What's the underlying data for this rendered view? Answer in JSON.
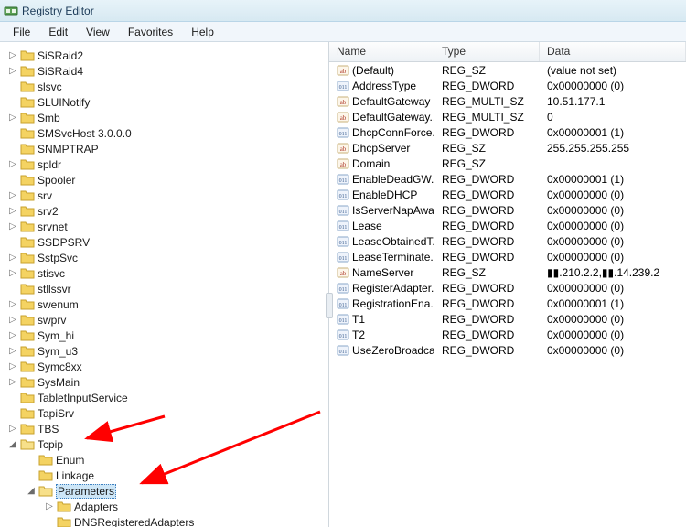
{
  "window": {
    "title": "Registry Editor"
  },
  "menu": {
    "items": [
      "File",
      "Edit",
      "View",
      "Favorites",
      "Help"
    ]
  },
  "tree": {
    "items": [
      {
        "label": "SiSRaid2",
        "indent": 1,
        "expandable": true
      },
      {
        "label": "SiSRaid4",
        "indent": 1,
        "expandable": true
      },
      {
        "label": "slsvc",
        "indent": 1,
        "expandable": false
      },
      {
        "label": "SLUINotify",
        "indent": 1,
        "expandable": false
      },
      {
        "label": "Smb",
        "indent": 1,
        "expandable": true
      },
      {
        "label": "SMSvcHost 3.0.0.0",
        "indent": 1,
        "expandable": false
      },
      {
        "label": "SNMPTRAP",
        "indent": 1,
        "expandable": false
      },
      {
        "label": "spldr",
        "indent": 1,
        "expandable": true
      },
      {
        "label": "Spooler",
        "indent": 1,
        "expandable": false
      },
      {
        "label": "srv",
        "indent": 1,
        "expandable": true
      },
      {
        "label": "srv2",
        "indent": 1,
        "expandable": true
      },
      {
        "label": "srvnet",
        "indent": 1,
        "expandable": true
      },
      {
        "label": "SSDPSRV",
        "indent": 1,
        "expandable": false
      },
      {
        "label": "SstpSvc",
        "indent": 1,
        "expandable": true
      },
      {
        "label": "stisvc",
        "indent": 1,
        "expandable": true
      },
      {
        "label": "stllssvr",
        "indent": 1,
        "expandable": false
      },
      {
        "label": "swenum",
        "indent": 1,
        "expandable": true
      },
      {
        "label": "swprv",
        "indent": 1,
        "expandable": true
      },
      {
        "label": "Sym_hi",
        "indent": 1,
        "expandable": true
      },
      {
        "label": "Sym_u3",
        "indent": 1,
        "expandable": true
      },
      {
        "label": "Symc8xx",
        "indent": 1,
        "expandable": true
      },
      {
        "label": "SysMain",
        "indent": 1,
        "expandable": true
      },
      {
        "label": "TabletInputService",
        "indent": 1,
        "expandable": false
      },
      {
        "label": "TapiSrv",
        "indent": 1,
        "expandable": false
      },
      {
        "label": "TBS",
        "indent": 1,
        "expandable": true
      },
      {
        "label": "Tcpip",
        "indent": 1,
        "expandable": true,
        "expanded": true
      },
      {
        "label": "Enum",
        "indent": 2,
        "expandable": false
      },
      {
        "label": "Linkage",
        "indent": 2,
        "expandable": false
      },
      {
        "label": "Parameters",
        "indent": 2,
        "expandable": true,
        "expanded": true,
        "selected": true
      },
      {
        "label": "Adapters",
        "indent": 3,
        "expandable": true
      },
      {
        "label": "DNSRegisteredAdapters",
        "indent": 3,
        "expandable": false
      }
    ]
  },
  "list": {
    "columns": {
      "name": "Name",
      "type": "Type",
      "data": "Data"
    },
    "rows": [
      {
        "icon": "ab",
        "name": "(Default)",
        "type": "REG_SZ",
        "data": "(value not set)"
      },
      {
        "icon": "bin",
        "name": "AddressType",
        "type": "REG_DWORD",
        "data": "0x00000000 (0)"
      },
      {
        "icon": "ab",
        "name": "DefaultGateway",
        "type": "REG_MULTI_SZ",
        "data": "10.51.177.1"
      },
      {
        "icon": "ab",
        "name": "DefaultGateway...",
        "type": "REG_MULTI_SZ",
        "data": "0"
      },
      {
        "icon": "bin",
        "name": "DhcpConnForce...",
        "type": "REG_DWORD",
        "data": "0x00000001 (1)"
      },
      {
        "icon": "ab",
        "name": "DhcpServer",
        "type": "REG_SZ",
        "data": "255.255.255.255"
      },
      {
        "icon": "ab",
        "name": "Domain",
        "type": "REG_SZ",
        "data": ""
      },
      {
        "icon": "bin",
        "name": "EnableDeadGW...",
        "type": "REG_DWORD",
        "data": "0x00000001 (1)"
      },
      {
        "icon": "bin",
        "name": "EnableDHCP",
        "type": "REG_DWORD",
        "data": "0x00000000 (0)"
      },
      {
        "icon": "bin",
        "name": "IsServerNapAware",
        "type": "REG_DWORD",
        "data": "0x00000000 (0)"
      },
      {
        "icon": "bin",
        "name": "Lease",
        "type": "REG_DWORD",
        "data": "0x00000000 (0)"
      },
      {
        "icon": "bin",
        "name": "LeaseObtainedT...",
        "type": "REG_DWORD",
        "data": "0x00000000 (0)"
      },
      {
        "icon": "bin",
        "name": "LeaseTerminate...",
        "type": "REG_DWORD",
        "data": "0x00000000 (0)"
      },
      {
        "icon": "ab",
        "name": "NameServer",
        "type": "REG_SZ",
        "data": "▮▮.210.2.2,▮▮.14.239.2"
      },
      {
        "icon": "bin",
        "name": "RegisterAdapter...",
        "type": "REG_DWORD",
        "data": "0x00000000 (0)"
      },
      {
        "icon": "bin",
        "name": "RegistrationEna...",
        "type": "REG_DWORD",
        "data": "0x00000001 (1)"
      },
      {
        "icon": "bin",
        "name": "T1",
        "type": "REG_DWORD",
        "data": "0x00000000 (0)"
      },
      {
        "icon": "bin",
        "name": "T2",
        "type": "REG_DWORD",
        "data": "0x00000000 (0)"
      },
      {
        "icon": "bin",
        "name": "UseZeroBroadcast",
        "type": "REG_DWORD",
        "data": "0x00000000 (0)"
      }
    ]
  }
}
